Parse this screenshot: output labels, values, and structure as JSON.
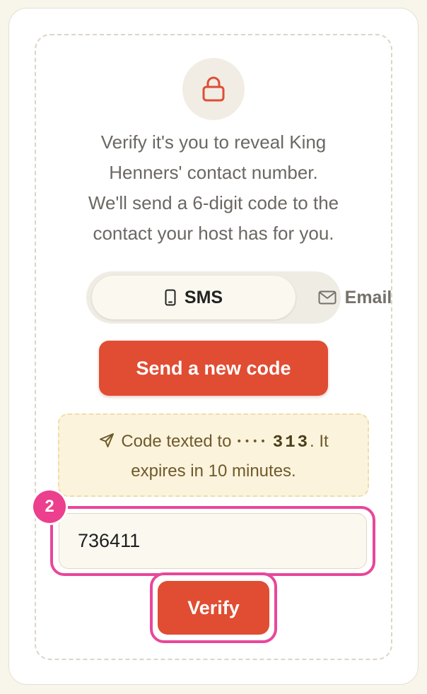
{
  "intro": {
    "line1": "Verify it's you to reveal King",
    "line2": "Henners' contact number.",
    "line3": "We'll send a 6-digit code to the",
    "line4": "contact your host has for you."
  },
  "channel_toggle": {
    "options": [
      {
        "label": "SMS",
        "icon": "phone-icon",
        "selected": true
      },
      {
        "label": "Email",
        "icon": "envelope-icon",
        "selected": false
      }
    ]
  },
  "send_button": {
    "label": "Send a new code"
  },
  "notice": {
    "prefix": "Code texted to",
    "masked": "••••",
    "last_digits": "313",
    "suffix": ". It",
    "line2": "expires in 10 minutes.",
    "icon": "send-icon"
  },
  "code_input": {
    "value": "736411"
  },
  "step_badge": {
    "label": "2"
  },
  "verify_button": {
    "label": "Verify"
  },
  "colors": {
    "accent": "#e04d33",
    "highlight": "#e8479a",
    "notice_bg": "#fcf3dd"
  }
}
